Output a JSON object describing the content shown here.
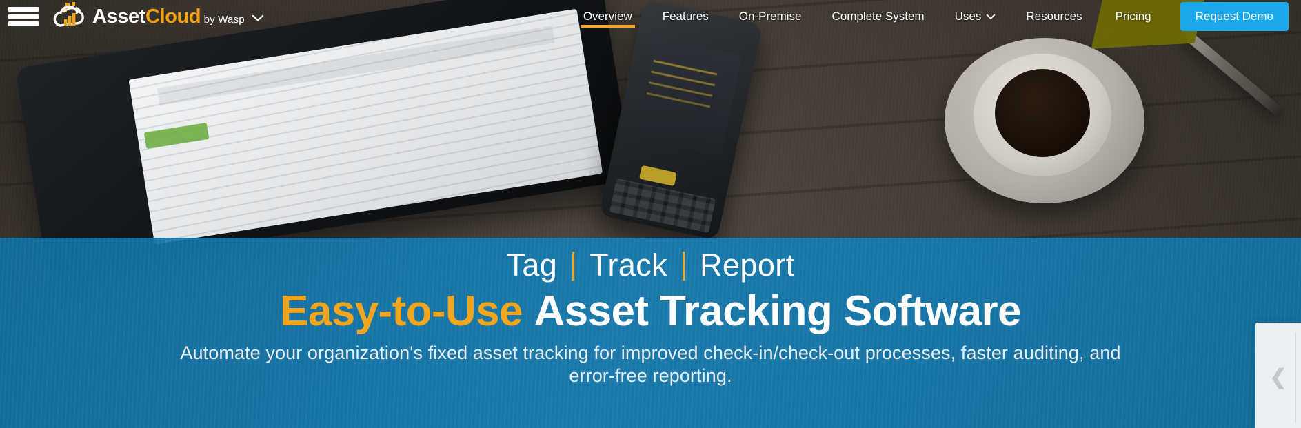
{
  "brand": {
    "logo_icon": "cloud-bar-chart-icon",
    "name_part_1": "Asset",
    "name_part_2": "Cloud",
    "tagline": "by Wasp",
    "caret_icon": "chevron-down-icon",
    "caret_glyph": "⌄"
  },
  "menu": {
    "hamburger_icon": "hamburger-menu-icon"
  },
  "nav": {
    "items": [
      {
        "label": "Overview",
        "active": true,
        "has_dropdown": false
      },
      {
        "label": "Features",
        "active": false,
        "has_dropdown": false
      },
      {
        "label": "On-Premise",
        "active": false,
        "has_dropdown": false
      },
      {
        "label": "Complete System",
        "active": false,
        "has_dropdown": false
      },
      {
        "label": "Uses",
        "active": false,
        "has_dropdown": true
      },
      {
        "label": "Resources",
        "active": false,
        "has_dropdown": false
      },
      {
        "label": "Pricing",
        "active": false,
        "has_dropdown": false
      }
    ],
    "uses_caret_glyph": "⌄",
    "cta_label": "Request Demo"
  },
  "hero": {
    "tagline_parts": [
      "Tag",
      "Track",
      "Report"
    ],
    "headline_accent": "Easy-to-Use",
    "headline_rest": "Asset Tracking Software",
    "subhead": "Automate your organization's fixed asset tracking for improved check-in/check-out processes, faster auditing, and error-free reporting."
  },
  "slideout": {
    "icon": "chevron-left-icon",
    "glyph": "❮"
  },
  "colors": {
    "brand_orange": "#f0a211",
    "accent_amber": "#f5a623",
    "hero_blue": "#1582ba",
    "cta_blue": "#19a9ec",
    "pricing_olive": "#6e6a06",
    "nav_text": "#ffffff",
    "slideout_bg": "#eaeff3"
  }
}
